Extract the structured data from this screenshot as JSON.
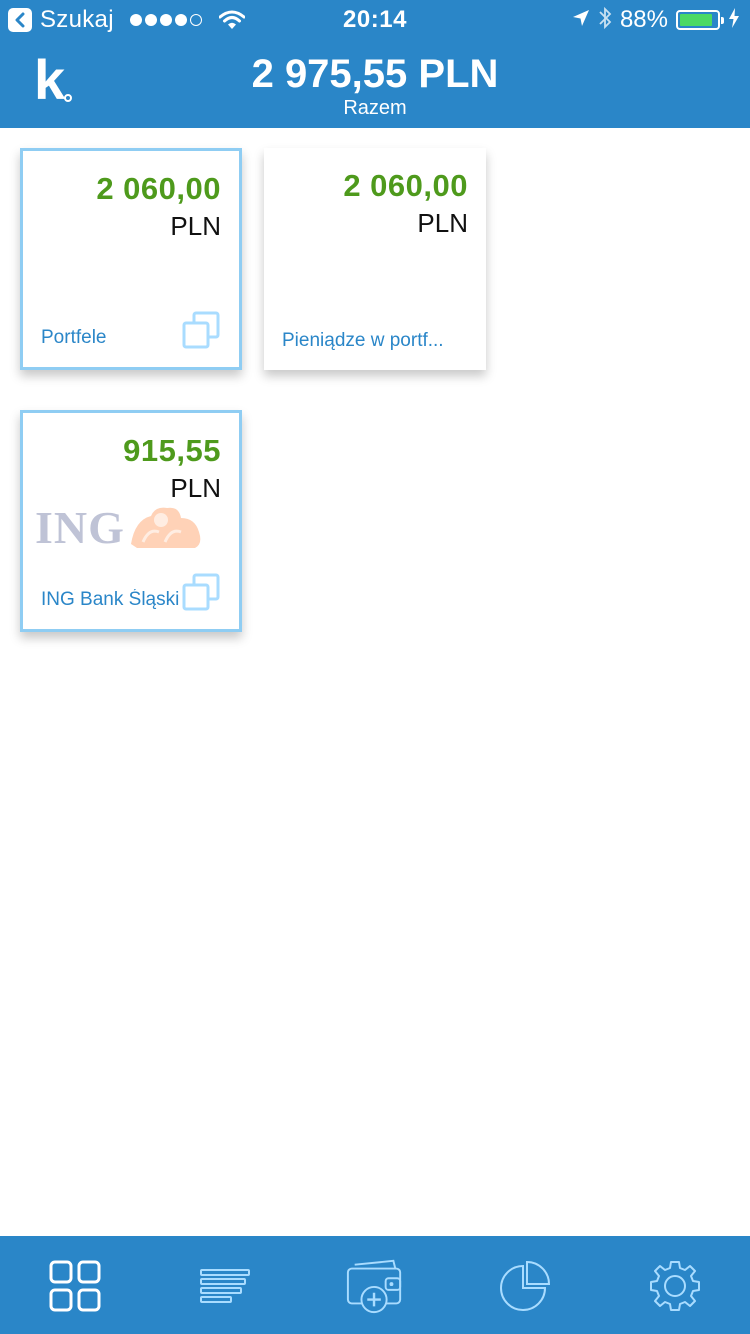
{
  "status_bar": {
    "back_label": "Szukaj",
    "time": "20:14",
    "battery_percent": "88%",
    "battery_level": 0.88,
    "signal_bars": 4,
    "signal_total": 5
  },
  "header": {
    "logo": "k",
    "total_amount": "2 975,55 PLN",
    "total_label": "Razem"
  },
  "tiles": [
    {
      "amount": "2 060,00",
      "currency": "PLN",
      "label": "Portfele",
      "selected": true,
      "has_copy_icon": true
    },
    {
      "amount": "2 060,00",
      "currency": "PLN",
      "label": "Pieniądze w portf...",
      "selected": false,
      "has_copy_icon": false
    },
    {
      "amount": "915,55",
      "currency": "PLN",
      "label": "ING Bank Śląski",
      "selected": true,
      "has_copy_icon": true,
      "logo": "ING"
    }
  ],
  "tabbar": {
    "items": [
      "grid-icon",
      "list-icon",
      "wallet-add-icon",
      "pie-chart-icon",
      "gear-icon"
    ]
  },
  "colors": {
    "brand_blue": "#2a86c8",
    "amount_green": "#4e9a1c",
    "tile_border": "#8fcdf3",
    "icon_light": "#a9dcff"
  }
}
